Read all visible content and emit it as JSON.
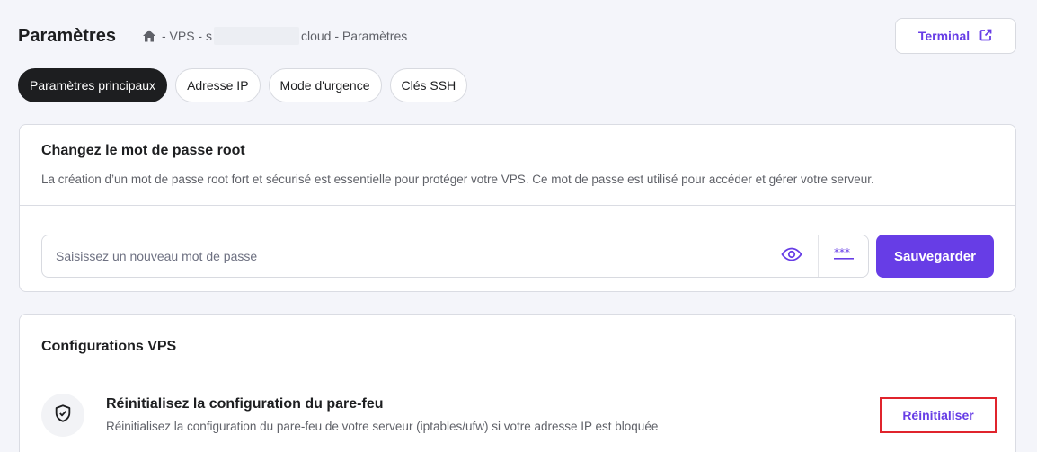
{
  "header": {
    "title": "Paramètres",
    "breadcrumb": {
      "part1": "- VPS - s",
      "part2": "cloud - Paramètres"
    },
    "terminal_label": "Terminal"
  },
  "tabs": [
    {
      "label": "Paramètres principaux",
      "active": true
    },
    {
      "label": "Adresse IP",
      "active": false
    },
    {
      "label": "Mode d'urgence",
      "active": false
    },
    {
      "label": "Clés SSH",
      "active": false
    }
  ],
  "password_card": {
    "title": "Changez le mot de passe root",
    "description": "La création d’un mot de passe root fort et sécurisé est essentielle pour protéger votre VPS. Ce mot de passe est utilisé pour accéder et gérer votre serveur.",
    "input_value": "",
    "input_placeholder": "Saisissez un nouveau mot de passe",
    "save_label": "Sauvegarder"
  },
  "vps_config_card": {
    "title": "Configurations VPS",
    "firewall": {
      "icon": "shield-check-icon",
      "title": "Réinitialisez la configuration du pare-feu",
      "description": "Réinitialisez la configuration du pare-feu de votre serveur (iptables/ufw) si votre adresse IP est bloquée",
      "button_label": "Réinitialiser"
    }
  },
  "colors": {
    "accent": "#673de6",
    "dark": "#1d1e20",
    "highlight": "#e0242c",
    "background": "#f4f5fa"
  }
}
